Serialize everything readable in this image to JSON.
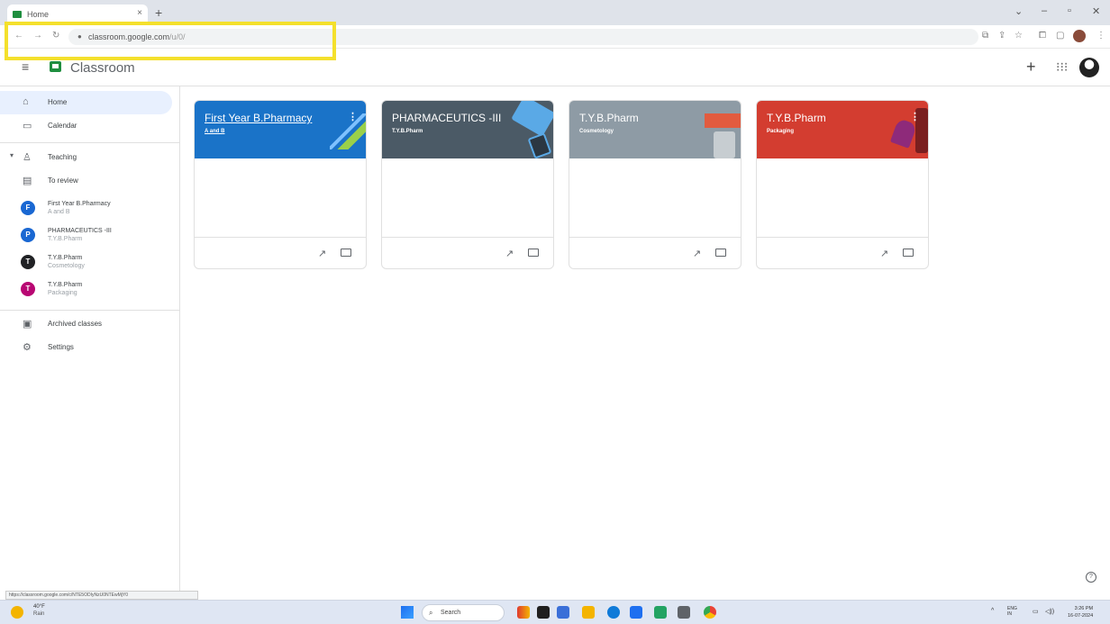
{
  "browser": {
    "tab_title": "Home",
    "tab_close": "×",
    "new_tab": "+",
    "address_domain": "classroom.google.com",
    "address_path": "/u/0/",
    "status_url": "https://classroom.google.com/c/NTE5ODIyNzU0NTEwMjY0"
  },
  "app": {
    "title": "Classroom",
    "add_symbol": "+",
    "menu_symbol": "≡",
    "apps_symbol": "⋮⋮"
  },
  "sidebar": {
    "items": [
      {
        "icon": "home-icon",
        "label": "Home"
      },
      {
        "icon": "calendar-icon",
        "label": "Calendar"
      },
      {
        "icon": "teaching-icon",
        "label": "Teaching"
      },
      {
        "icon": "to-review-icon",
        "label": "To review"
      },
      {
        "icon": "archive-icon",
        "label": "Archived classes"
      },
      {
        "icon": "settings-icon",
        "label": "Settings"
      }
    ],
    "classes": [
      {
        "letter": "F",
        "name": "First Year B.Pharmacy",
        "section": "A and B",
        "color": "#1967d2"
      },
      {
        "letter": "P",
        "name": "PHARMACEUTICS -III",
        "section": "T.Y.B.Pharm",
        "color": "#1967d2"
      },
      {
        "letter": "T",
        "name": "T.Y.B.Pharm",
        "section": "Cosmetology",
        "color": "#202124"
      },
      {
        "letter": "T",
        "name": "T.Y.B.Pharm",
        "section": "Packaging",
        "color": "#b80672"
      }
    ]
  },
  "cards": [
    {
      "title": "First Year B.Pharmacy",
      "section": "A and B",
      "color": "#1a73c8"
    },
    {
      "title": "PHARMACEUTICS -III",
      "section": "T.Y.B.Pharm",
      "color": "#4b5a66"
    },
    {
      "title": "T.Y.B.Pharm",
      "section": "Cosmetology",
      "color": "#8e9ba5"
    },
    {
      "title": "T.Y.B.Pharm",
      "section": "Packaging",
      "color": "#d33d30"
    }
  ],
  "taskbar": {
    "weather_temp": "40°F",
    "weather_desc": "Rain",
    "search_label": "Search",
    "lang": "ENG\nIN",
    "time": "3:26 PM",
    "date": "16-07-2024"
  }
}
